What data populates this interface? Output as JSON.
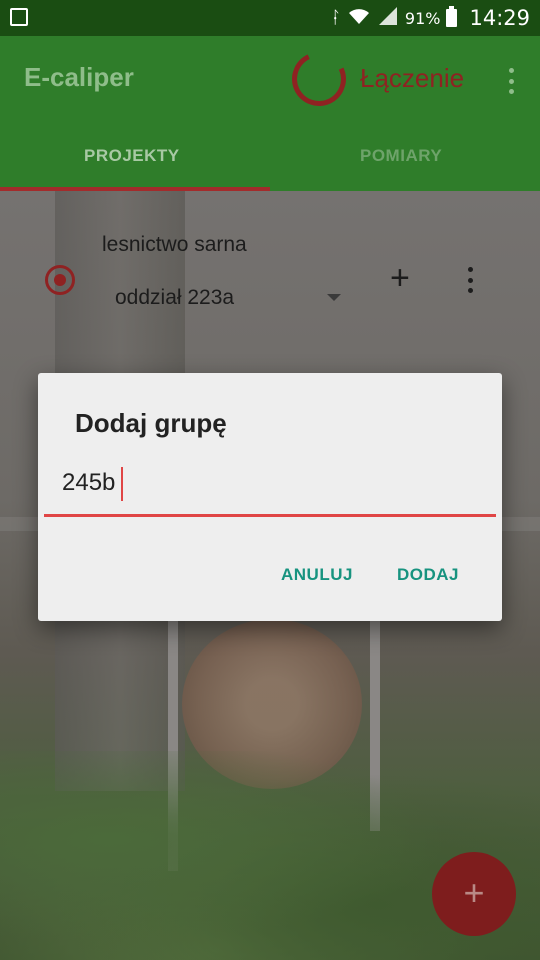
{
  "status_bar": {
    "icons": [
      "gallery-icon",
      "bluetooth-icon",
      "wifi-icon",
      "signal-icon",
      "battery-icon"
    ],
    "battery": "91%",
    "time": "14:29"
  },
  "app_bar": {
    "title": "E-caliper",
    "connection_status": "Łączenie",
    "tabs": [
      {
        "label": "PROJEKTY",
        "selected": true
      },
      {
        "label": "POMIARY",
        "selected": false
      }
    ]
  },
  "project": {
    "name": "lesnictwo sarna",
    "selected_group": "oddział 223a",
    "add_symbol": "+"
  },
  "fab": {
    "symbol": "+"
  },
  "dialog": {
    "title": "Dodaj grupę",
    "input_value": "245b",
    "cancel_label": "ANULUJ",
    "confirm_label": "DODAJ"
  },
  "colors": {
    "status_bar": "#1a4d12",
    "app_bar": "#2f7d2a",
    "accent_red": "#e04545",
    "button_teal": "#17937f",
    "dialog_bg": "#eeeeee"
  }
}
